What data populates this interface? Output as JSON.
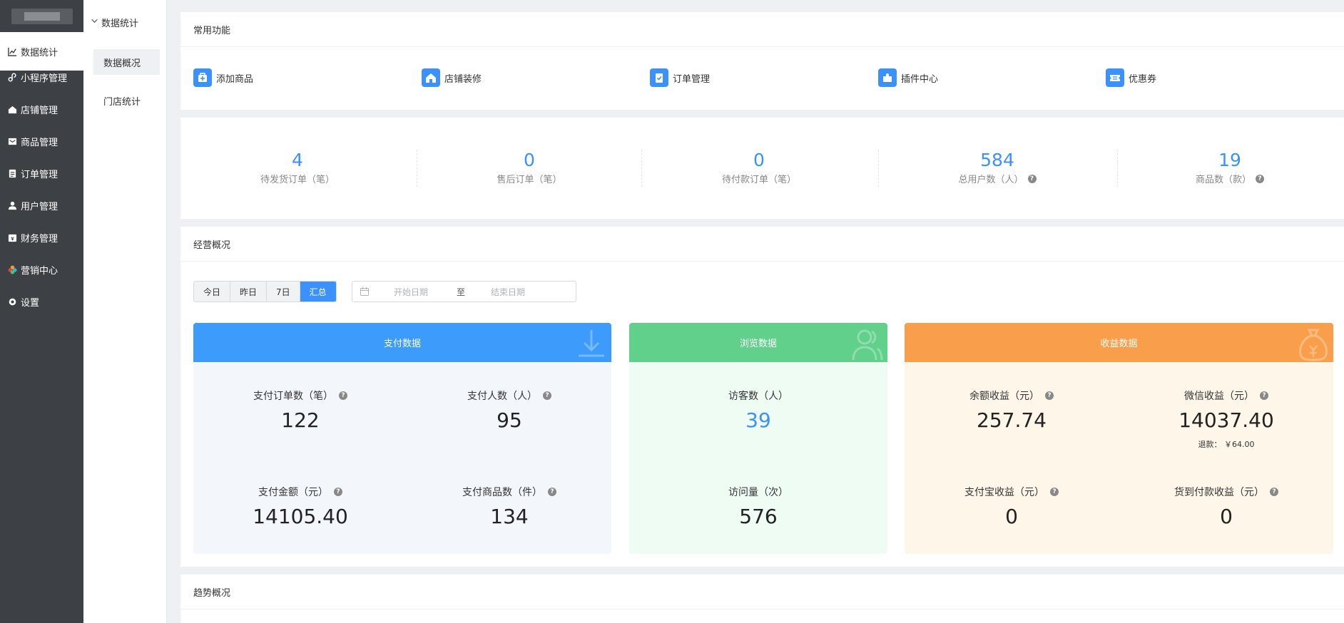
{
  "nav": {
    "items": [
      {
        "label": "数据统计",
        "icon": "chart-icon"
      },
      {
        "label": "小程序管理",
        "icon": "link-icon"
      },
      {
        "label": "店铺管理",
        "icon": "home-icon"
      },
      {
        "label": "商品管理",
        "icon": "box-icon"
      },
      {
        "label": "订单管理",
        "icon": "clipboard-icon"
      },
      {
        "label": "用户管理",
        "icon": "user-icon"
      },
      {
        "label": "财务管理",
        "icon": "wallet-icon"
      },
      {
        "label": "营销中心",
        "icon": "flower-icon"
      },
      {
        "label": "设置",
        "icon": "gear-icon"
      }
    ]
  },
  "subnav": {
    "title": "数据统计",
    "items": [
      {
        "label": "数据概况"
      },
      {
        "label": "门店统计"
      }
    ]
  },
  "quick": {
    "title": "常用功能",
    "items": [
      {
        "label": "添加商品",
        "icon": "add-product-icon"
      },
      {
        "label": "店铺装修",
        "icon": "store-icon"
      },
      {
        "label": "订单管理",
        "icon": "order-icon"
      },
      {
        "label": "插件中心",
        "icon": "plugin-icon"
      },
      {
        "label": "优惠券",
        "icon": "coupon-icon"
      }
    ]
  },
  "stats": [
    {
      "value": "4",
      "label": "待发货订单（笔）"
    },
    {
      "value": "0",
      "label": "售后订单（笔）"
    },
    {
      "value": "0",
      "label": "待付款订单（笔）"
    },
    {
      "value": "584",
      "label": "总用户数（人）"
    },
    {
      "value": "19",
      "label": "商品数（款）"
    }
  ],
  "business": {
    "title": "经营概况",
    "ranges": [
      "今日",
      "昨日",
      "7日",
      "汇总"
    ],
    "active_range": "汇总",
    "date_start_placeholder": "开始日期",
    "date_sep": "至",
    "date_end_placeholder": "结束日期"
  },
  "panels": {
    "pay": {
      "title": "支付数据",
      "color": "#3d9bfb",
      "bg": "#f3f7fc",
      "metrics": [
        {
          "label": "支付订单数（笔）",
          "value": "122"
        },
        {
          "label": "支付人数（人）",
          "value": "95"
        },
        {
          "label": "支付金额（元）",
          "value": "14105.40"
        },
        {
          "label": "支付商品数（件）",
          "value": "134"
        }
      ]
    },
    "browse": {
      "title": "浏览数据",
      "color": "#60d08b",
      "bg": "#effcf4",
      "metrics": [
        {
          "label": "访客数（人）",
          "value": "39"
        },
        {
          "label": "访问量（次）",
          "value": "576"
        }
      ]
    },
    "income": {
      "title": "收益数据",
      "color": "#f99f4b",
      "bg": "#fef6e9",
      "metrics": [
        {
          "label": "余额收益（元）",
          "value": "257.74"
        },
        {
          "label": "微信收益（元）",
          "value": "14037.40",
          "note": "退款： ￥64.00"
        },
        {
          "label": "支付宝收益（元）",
          "value": "0"
        },
        {
          "label": "货到付款收益（元）",
          "value": "0"
        }
      ]
    }
  },
  "trend": {
    "title": "趋势概况"
  }
}
